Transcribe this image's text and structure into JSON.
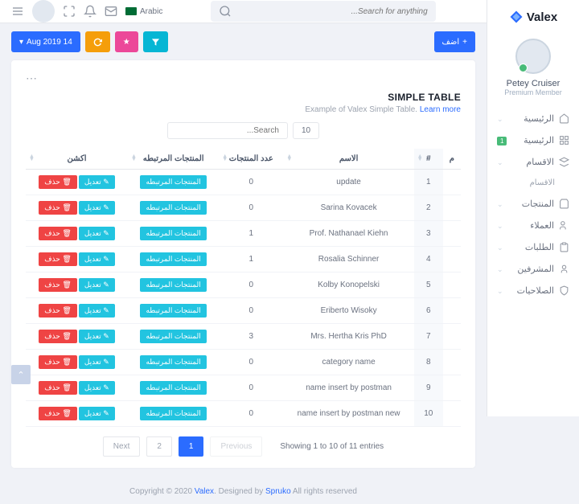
{
  "brand": "Valex",
  "user": {
    "name": "Petey Cruiser",
    "role": "Premium Member"
  },
  "nav": {
    "items": [
      {
        "label": "الرئيسية",
        "icon": "home",
        "chev": true
      },
      {
        "label": "الرئيسية",
        "icon": "grid",
        "badge": "1"
      },
      {
        "label": "الاقسام",
        "icon": "layers",
        "chev": true
      },
      {
        "label": "الاقسام",
        "icon": "",
        "sub": true
      },
      {
        "label": "المنتجات",
        "icon": "bag",
        "chev": true
      },
      {
        "label": "العملاء",
        "icon": "users",
        "chev": true
      },
      {
        "label": "الطلبات",
        "icon": "clipboard",
        "chev": true
      },
      {
        "label": "المشرفين",
        "icon": "admin",
        "chev": true
      },
      {
        "label": "الصلاحيات",
        "icon": "shield",
        "chev": true
      }
    ]
  },
  "header": {
    "lang": "Arabic",
    "search_placeholder": "...Search for anything"
  },
  "toolbar": {
    "date": "Aug 2019 14",
    "add": "اضف"
  },
  "card": {
    "title": "SIMPLE TABLE",
    "sub_prefix": "Example of Valex Simple Table. ",
    "sub_link": "Learn more",
    "search": "...Search",
    "page_size": "10"
  },
  "table": {
    "headers": {
      "actions": "اكشن",
      "related": "المنتجات المرتبطه",
      "count": "عدد المنتجات",
      "name": "الاسم",
      "num": "#",
      "sort": "م"
    },
    "btn_related": "المنتجات المرتبطه",
    "btn_delete": "حذف",
    "btn_edit": "تعديل",
    "rows": [
      {
        "n": 1,
        "name": "update",
        "count": 0
      },
      {
        "n": 2,
        "name": "Sarina Kovacek",
        "count": 0
      },
      {
        "n": 3,
        "name": "Prof. Nathanael Kiehn",
        "count": 1
      },
      {
        "n": 4,
        "name": "Rosalia Schinner",
        "count": 1
      },
      {
        "n": 5,
        "name": "Kolby Konopelski",
        "count": 0
      },
      {
        "n": 6,
        "name": "Eriberto Wisoky",
        "count": 0
      },
      {
        "n": 7,
        "name": "Mrs. Hertha Kris PhD",
        "count": 3
      },
      {
        "n": 8,
        "name": "category name",
        "count": 0
      },
      {
        "n": 9,
        "name": "name insert by postman",
        "count": 0
      },
      {
        "n": 10,
        "name": "name insert by postman new",
        "count": 0
      }
    ]
  },
  "pager": {
    "info": "Showing 1 to 10 of 11 entries",
    "prev": "Previous",
    "next": "Next",
    "p1": "1",
    "p2": "2"
  },
  "footer": {
    "pre": "Copyright © 2020 ",
    "brand": "Valex",
    "mid": ". Designed by ",
    "by": "Spruko",
    "post": " All rights reserved"
  }
}
